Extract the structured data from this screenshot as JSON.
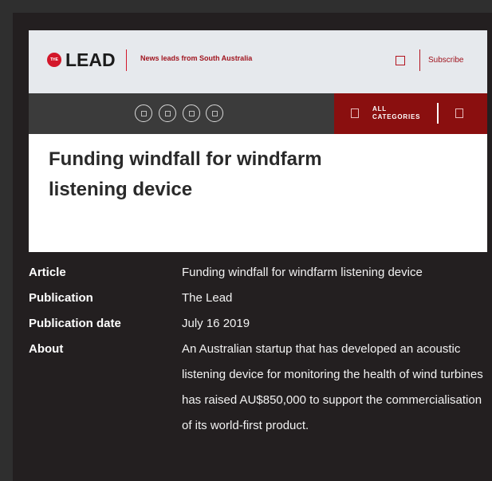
{
  "header": {
    "logo_badge": "THE",
    "logo_text": "LEAD",
    "tagline": "News leads from South Australia",
    "subscribe_label": "Subscribe"
  },
  "nav": {
    "social_icons": [
      "facebook-icon",
      "twitter-icon",
      "linkedin-icon",
      "email-icon"
    ],
    "categories_label": "ALL CATEGORIES"
  },
  "article": {
    "headline": "Funding windfall for windfarm listening device"
  },
  "details": [
    {
      "key": "Article",
      "value": "Funding windfall for windfarm listening device"
    },
    {
      "key": "Publication",
      "value": "The Lead"
    },
    {
      "key": "Publication date",
      "value": "July 16 2019"
    },
    {
      "key": "About",
      "value": "An Australian startup that has developed an acoustic listening device for monitoring the health of wind turbines has raised AU$850,000 to support the commercialisation of its world-first product."
    }
  ],
  "colors": {
    "brand_red": "#d3172a",
    "category_bar": "#8a0f0f",
    "nav_dark": "#3b3b3b",
    "panel_bg": "#231f20"
  }
}
